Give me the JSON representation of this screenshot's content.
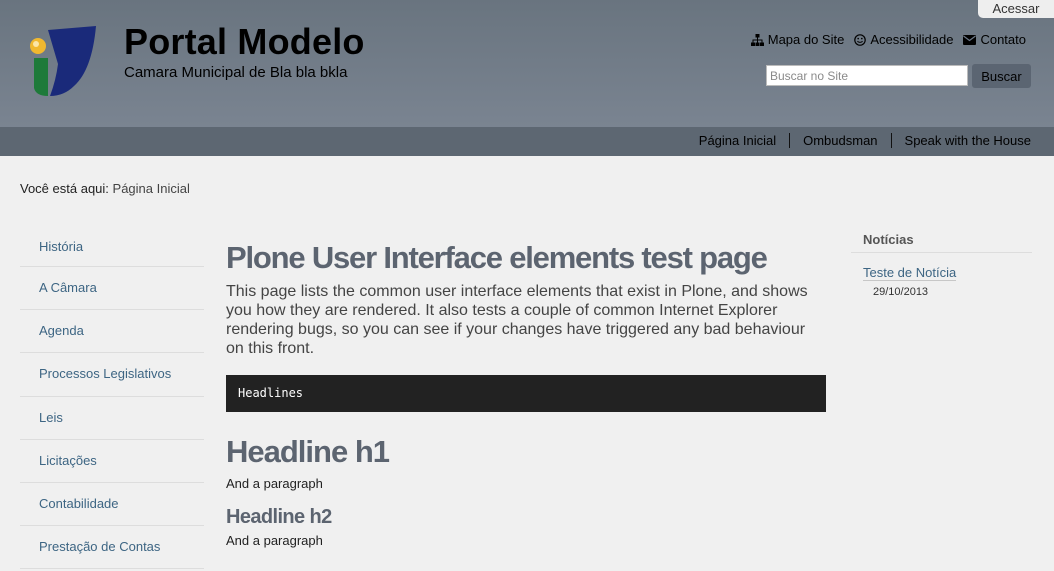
{
  "header": {
    "login_label": "Acessar",
    "title": "Portal Modelo",
    "subtitle": "Camara Municipal de Bla bla bkla",
    "site_actions": [
      {
        "label": "Mapa do Site",
        "icon": "sitemap-icon"
      },
      {
        "label": "Acessibilidade",
        "icon": "smiley-icon"
      },
      {
        "label": "Contato",
        "icon": "envelope-icon"
      }
    ],
    "search": {
      "placeholder": "Buscar no Site",
      "value": "",
      "button_label": "Buscar"
    }
  },
  "globalnav": {
    "items": [
      "Página Inicial",
      "Ombudsman",
      "Speak with the House"
    ]
  },
  "breadcrumb": {
    "prefix": "Você está aqui:",
    "items": [
      "Página Inicial"
    ]
  },
  "leftnav": {
    "items": [
      "História",
      "A Câmara",
      "Agenda",
      "Processos Legislativos",
      "Leis",
      "Licitações",
      "Contabilidade",
      "Prestação de Contas"
    ]
  },
  "content": {
    "title": "Plone User Interface elements test page",
    "description": "This page lists the common user interface elements that exist in Plone, and shows you how they are rendered. It also tests a couple of common Internet Explorer rendering bugs, so you can see if your changes have triggered any bad behaviour on this front.",
    "pre": "Headlines",
    "h1": "Headline h1",
    "p1": "And a paragraph",
    "h2": "Headline h2",
    "p2": "And a paragraph"
  },
  "portlet": {
    "title": "Notícias",
    "news": [
      {
        "title": "Teste de Notícia",
        "date": "29/10/2013"
      }
    ]
  },
  "colors": {
    "header_bg": "#6c7787",
    "nav_bg": "#5d6772",
    "link": "#3d6583",
    "heading": "#5c6470",
    "logo_blue": "#1a2a7a",
    "logo_green": "#1e7a3a",
    "logo_gold": "#f0b830"
  }
}
